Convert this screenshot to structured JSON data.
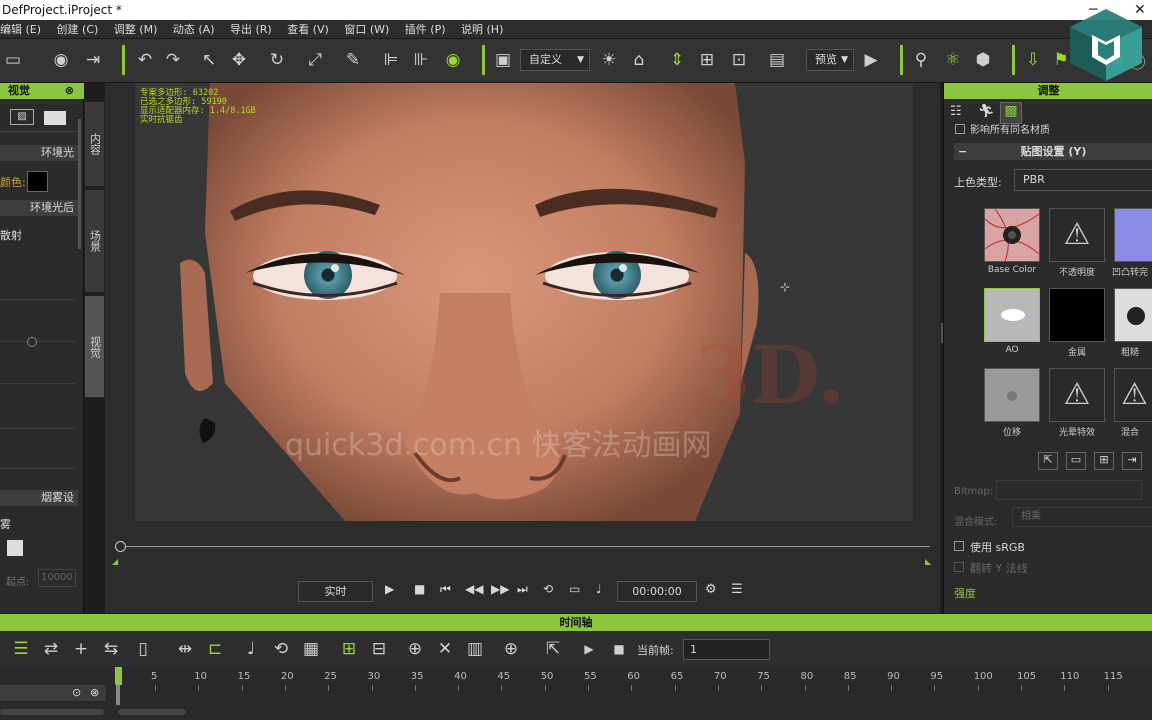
{
  "window": {
    "title": "DefProject.iProject *"
  },
  "menu": [
    "编辑 (E)",
    "创建 (C)",
    "调整 (M)",
    "动态 (A)",
    "导出 (R)",
    "查看 (V)",
    "窗口 (W)",
    "插件 (P)",
    "说明 (H)"
  ],
  "toolbar": {
    "view_combo": "自定义",
    "preview_combo": "预览"
  },
  "left_panel": {
    "header": "视觉",
    "sections": [
      "环境光",
      "环境光后"
    ],
    "color_label": "颜色:",
    "scatter_label": "散射",
    "fog_header": "烟雾设",
    "fog_item": "雾",
    "start_label": "起点:",
    "start_value": "10000"
  },
  "side_tabs": [
    "内容",
    "场景",
    "视觉"
  ],
  "viewport": {
    "stats": [
      "专案多边形: 63202",
      "已选之多边形: 59190",
      "显示适配器内存: 1.4/8.1GB",
      "实时抗锯齿"
    ],
    "watermark_1": "quick3d.com.cn 快客法动画网",
    "watermark_2": "3D."
  },
  "playback": {
    "mode": "实时",
    "time": "00:00:00"
  },
  "right_panel": {
    "header": "调整",
    "affect_label": "影响所有同名材质",
    "map_section": "贴图设置 (Y)",
    "shader_label": "上色类型:",
    "shader_value": "PBR",
    "thumbs": [
      {
        "label": "Base Color"
      },
      {
        "label": "不透明度"
      },
      {
        "label": "凹凸转完"
      },
      {
        "label": "AO"
      },
      {
        "label": "金属"
      },
      {
        "label": "粗糙"
      },
      {
        "label": "位移"
      },
      {
        "label": "光晕特效"
      },
      {
        "label": "混合"
      }
    ],
    "bitmap_label": "Bitmap:",
    "blend_label": "混合模式:",
    "blend_value": "相乘",
    "srgb_label": "使用 sRGB",
    "flip_label": "翻转 Y 法线",
    "strength_label": "强度"
  },
  "timeline": {
    "header": "时间轴",
    "current_frame_label": "当前帧:",
    "current_frame": "1",
    "ticks": [
      "5",
      "10",
      "15",
      "20",
      "25",
      "30",
      "35",
      "40",
      "45",
      "50",
      "55",
      "60",
      "65",
      "70",
      "75",
      "80",
      "85",
      "90",
      "95",
      "100",
      "105",
      "110",
      "115"
    ]
  },
  "colors": {
    "accent": "#8cc63f",
    "stats": "#b7d72a"
  }
}
